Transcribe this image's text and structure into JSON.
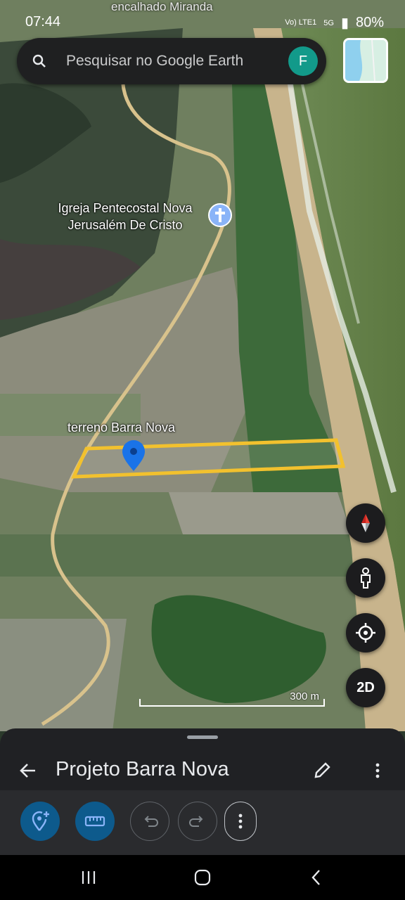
{
  "status": {
    "time": "07:44",
    "battery": "80%",
    "network": "Vo) LTE1",
    "network_gen": "5G"
  },
  "top_place_label": "encalhado Miranda",
  "search": {
    "placeholder": "Pesquisar no Google Earth",
    "avatar_letter": "F"
  },
  "map": {
    "church_label": "Igreja Pentecostal Nova Jerusalém De Cristo",
    "church_label_line1": "Igreja Pentecostal Nova",
    "church_label_line2": "Jerusalém De Cristo",
    "plot_label": "terreno Barra Nova",
    "scale_label": "300 m",
    "plot_outline_color": "#f2c12e",
    "pin_color": "#1a73e8"
  },
  "controls": {
    "compass": "compass-icon",
    "pegman": "pegman-icon",
    "locate": "my-location-icon",
    "view_mode": "2D"
  },
  "sheet": {
    "title": "Projeto Barra Nova"
  },
  "toolbar": {
    "items": [
      "add-placemark-icon",
      "measure-icon",
      "undo-icon",
      "redo-icon",
      "more-icon"
    ]
  },
  "navbar": {
    "items": [
      "recents-icon",
      "home-icon",
      "back-icon"
    ]
  }
}
